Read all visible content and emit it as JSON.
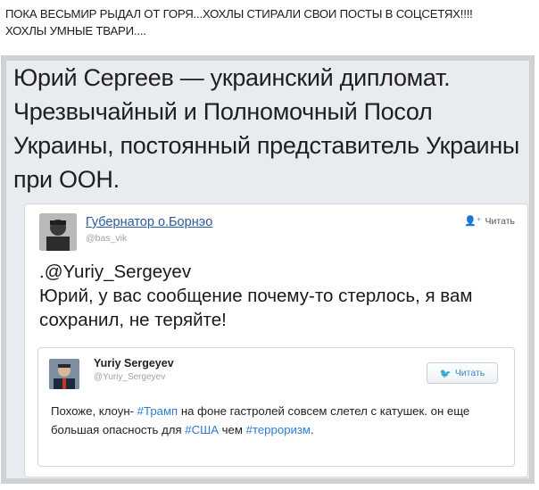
{
  "caption": {
    "line1": "ПОКА ВЕСЬМИР РЫДАЛ ОТ ГОРЯ...ХОХЛЫ СТИРАЛИ СВОИ ПОСТЫ В СОЦСЕТЯХ!!!!",
    "line2": "ХОХЛЫ УМНЫЕ ТВАРИ...."
  },
  "headline": {
    "text": "Юрий Сергеев — украинский дипломат. Чрезвычайный и Полномочный Посол Украины, постоянный представитель Украины при ООН."
  },
  "tweet": {
    "author_name": "Губернатор о.Борнэо",
    "author_handle": "@bas_vik",
    "follow_label": "Читать",
    "mention": ".@Yuriy_Sergeyev",
    "text": "Юрий, у вас сообщение почему-то стерлось, я вам сохранил, не теряйте!"
  },
  "quoted": {
    "author_name": "Yuriy Sergeyev",
    "author_handle": "@Yuriy_Sergeyev",
    "follow_label": "Читать",
    "text_part1": "Похоже, клоун- ",
    "hashtag1": "#Трамп",
    "text_part2": " на фоне гастролей совсем слетел с катушек. он еще большая опасность для ",
    "hashtag2": "#США",
    "text_part3": " чем ",
    "hashtag3": "#терроризм",
    "text_part4": "."
  },
  "colors": {
    "link": "#2b5a9c",
    "hashtag": "#2b7ed4",
    "frame": "#cfd0d2"
  }
}
